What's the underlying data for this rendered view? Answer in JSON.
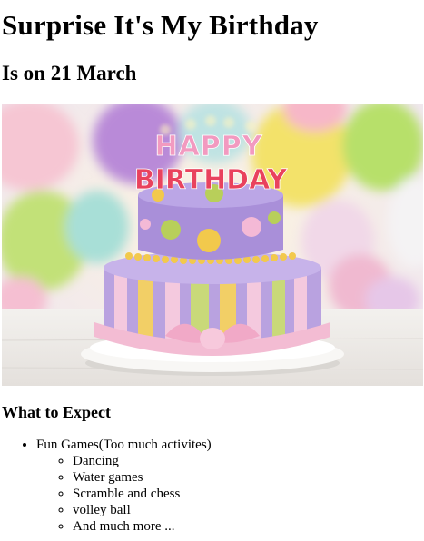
{
  "heading": "Surprise It's My Birthday",
  "subheading": "Is on 21 March",
  "image": {
    "name": "birthday-cake-photo",
    "cake_text_line1": "HAPPY",
    "cake_text_line2": "BIRTHDAY"
  },
  "section_title": "What to Expect",
  "list": {
    "item1": "Fun Games(Too much activites)",
    "subitems": [
      "Dancing",
      "Water games",
      "Scramble and chess",
      "volley ball",
      "And much more ..."
    ]
  }
}
